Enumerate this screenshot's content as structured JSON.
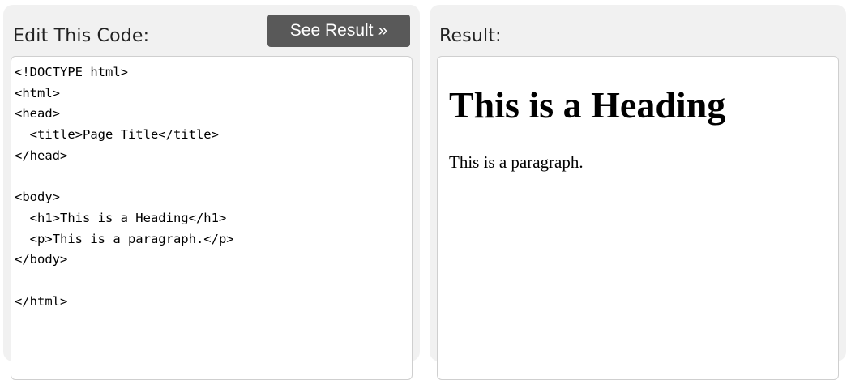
{
  "editor": {
    "title": "Edit This Code:",
    "run_button": {
      "label": "See Result",
      "icon": "double-chevron-right-icon",
      "glyph": "»"
    },
    "code": "<!DOCTYPE html>\n<html>\n<head>\n  <title>Page Title</title>\n</head>\n\n<body>\n  <h1>This is a Heading</h1>\n  <p>This is a paragraph.</p>\n</body>\n\n</html>"
  },
  "result": {
    "title": "Result:",
    "heading": "This is a Heading",
    "paragraph": "This is a paragraph."
  },
  "colors": {
    "panel_bg": "#f1f1f1",
    "button_bg": "#595959",
    "button_text": "#ffffff",
    "box_border": "#cfcfcf"
  }
}
